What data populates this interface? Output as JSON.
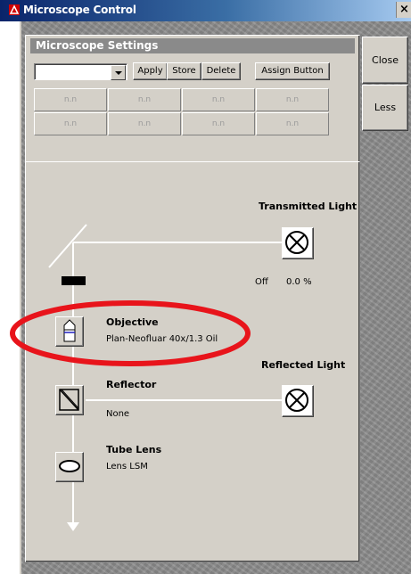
{
  "window": {
    "title": "Microscope Control",
    "close_glyph": "×",
    "icon": "zeiss-app-icon"
  },
  "side": {
    "close_label": "Close",
    "less_label": "Less"
  },
  "settings": {
    "header": "Microscope Settings",
    "preset_value": "",
    "apply_label": "Apply",
    "store_label": "Store",
    "delete_label": "Delete",
    "assign_label": "Assign Button",
    "slots": [
      "n.n",
      "n.n",
      "n.n",
      "n.n",
      "n.n",
      "n.n",
      "n.n",
      "n.n"
    ]
  },
  "lightpath": {
    "transmitted": {
      "title": "Transmitted Light",
      "state": "Off",
      "intensity": "0.0 %",
      "icon": "lamp-icon"
    },
    "objective": {
      "title": "Objective",
      "value": "Plan-Neofluar 40x/1.3 Oil",
      "icon": "objective-icon"
    },
    "reflected": {
      "title": "Reflected Light",
      "icon": "lamp-icon"
    },
    "reflector": {
      "title": "Reflector",
      "value": "None",
      "icon": "reflector-icon"
    },
    "tube_lens": {
      "title": "Tube Lens",
      "value": "Lens LSM",
      "icon": "tube-lens-icon"
    }
  },
  "colors": {
    "annotation_ellipse": "#e8141b",
    "beam": "#ffffff",
    "panel": "#d4d0c8",
    "background": "#8d8d8d"
  }
}
